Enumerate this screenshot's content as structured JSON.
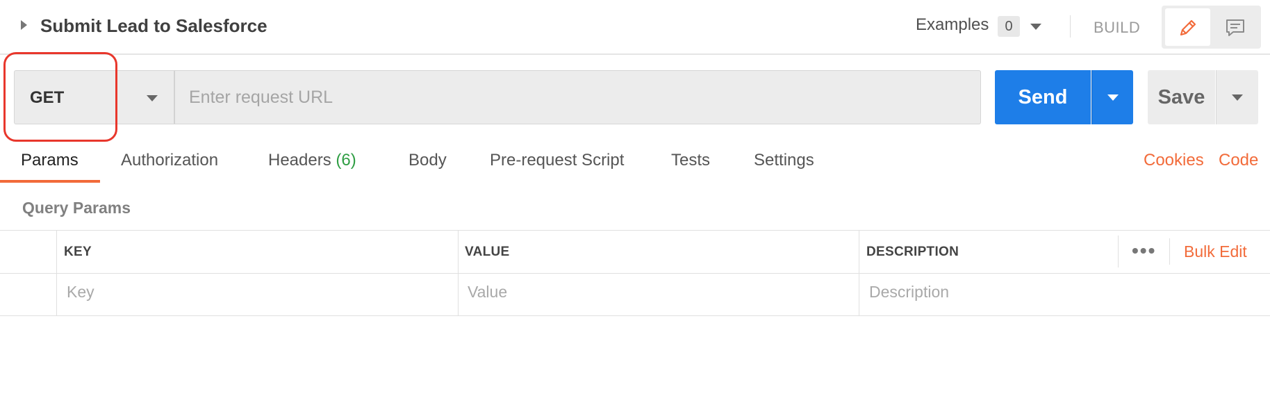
{
  "request": {
    "name": "Submit Lead to Salesforce",
    "method": "GET",
    "url_value": "",
    "url_placeholder": "Enter request URL"
  },
  "header": {
    "examples_label": "Examples",
    "examples_count": "0",
    "build_label": "BUILD",
    "icons": {
      "expand": "caret-right-icon",
      "examples_dropdown": "chevron-down-icon",
      "edit_mode": "pencil-icon",
      "comments_mode": "comment-icon"
    }
  },
  "actions": {
    "send_label": "Send",
    "save_label": "Save"
  },
  "tabs": [
    {
      "label": "Params",
      "active": true
    },
    {
      "label": "Authorization"
    },
    {
      "label": "Headers",
      "count": "(6)"
    },
    {
      "label": "Body"
    },
    {
      "label": "Pre-request Script"
    },
    {
      "label": "Tests"
    },
    {
      "label": "Settings"
    }
  ],
  "links": {
    "cookies": "Cookies",
    "code": "Code"
  },
  "query_params": {
    "title": "Query Params",
    "columns": [
      "KEY",
      "VALUE",
      "DESCRIPTION"
    ],
    "more_label": "•••",
    "bulk_edit_label": "Bulk Edit",
    "placeholders": {
      "key": "Key",
      "value": "Value",
      "description": "Description"
    }
  },
  "colors": {
    "accent": "#f26b3a",
    "primary": "#1e7ee8",
    "highlight": "#e8372c",
    "count_green": "#2f9e44"
  }
}
